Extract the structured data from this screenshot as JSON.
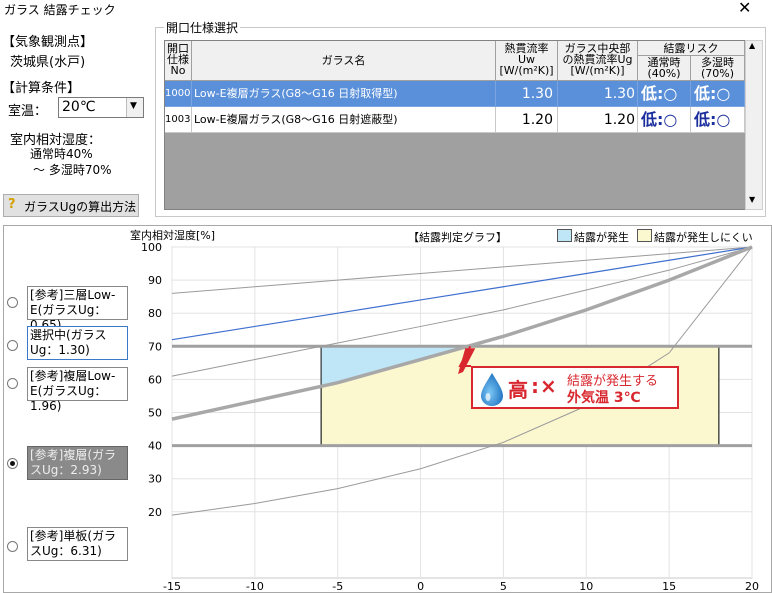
{
  "window": {
    "title": "ガラス 結露チェック",
    "close_glyph": "✕"
  },
  "station": {
    "label": "【気象観測点】",
    "value": "茨城県(水戸)"
  },
  "calc": {
    "label": "【計算条件】",
    "room_temp_label": "室温：",
    "room_temp_value": "20℃",
    "rh_label": "室内相対湿度：",
    "rh_normal": "通常時40%",
    "rh_humid": "～ 多湿時70%"
  },
  "calc_button": {
    "label": "ガラスUgの算出方法"
  },
  "selection": {
    "group_title": "開口仕様選択",
    "headers": {
      "no": [
        "開口",
        "仕様",
        "No"
      ],
      "name": "ガラス名",
      "uw": [
        "熱貫流率",
        "Uw",
        "[W/(m²K)]"
      ],
      "ug": [
        "ガラス中央部",
        "の熱貫流率Ug",
        "[W/(m²K)]"
      ],
      "risk": "結露リスク",
      "risk_normal": [
        "通常時",
        "(40%)"
      ],
      "risk_humid": [
        "多湿時",
        "(70%)"
      ]
    },
    "rows": [
      {
        "no": "1000",
        "name": "Low-E複層ガラス(G8～G16 日射取得型)",
        "uw": "1.30",
        "ug": "1.30",
        "risk_normal": "低:○",
        "risk_humid": "低:○"
      },
      {
        "no": "1003",
        "name": "Low-E複層ガラス(G8～G16 日射遮蔽型)",
        "uw": "1.20",
        "ug": "1.20",
        "risk_normal": "低:○",
        "risk_humid": "低:○"
      }
    ]
  },
  "chart_data": {
    "type": "line",
    "title": "【結露判定グラフ】",
    "ylabel": "室内相対湿度[%]",
    "xlim": [
      -15,
      20
    ],
    "ylim": [
      0,
      100
    ],
    "xticks": [
      -15,
      -10,
      -5,
      0,
      5,
      10,
      15,
      20
    ],
    "yticks": [
      20,
      30,
      40,
      50,
      60,
      70,
      80,
      90,
      100
    ],
    "legend": [
      {
        "label": "結露が発生",
        "color": "#bfe6f7"
      },
      {
        "label": "結露が発生しにくい",
        "color": "#fbf8cf"
      }
    ],
    "zone": {
      "x_range": [
        -6,
        18
      ],
      "rh_range": [
        40,
        70
      ]
    },
    "series": [
      {
        "name": "[参考]三層Low-E(ガラスUg：0.65)",
        "ug": 0.65,
        "color": "#9a9a9a",
        "x": [
          -15,
          -10,
          -5,
          0,
          5,
          10,
          15,
          20
        ],
        "y": [
          86,
          88,
          90,
          92,
          94,
          96,
          98,
          100
        ]
      },
      {
        "name": "選択中(ガラスUg：1.30)",
        "ug": 1.3,
        "color": "#3f6fcf",
        "x": [
          -15,
          -10,
          -5,
          0,
          5,
          10,
          15,
          20
        ],
        "y": [
          72,
          76,
          80,
          84,
          88,
          92,
          96,
          100
        ]
      },
      {
        "name": "[参考]複層Low-E(ガラスUg：1.96)",
        "ug": 1.96,
        "color": "#9a9a9a",
        "x": [
          -15,
          -10,
          -5,
          0,
          5,
          10,
          15,
          20
        ],
        "y": [
          61,
          66,
          71,
          76,
          81,
          87,
          93,
          100
        ]
      },
      {
        "name": "[参考]複層(ガラスUg：2.93)",
        "ug": 2.93,
        "color": "#a8a8a8",
        "x": [
          -15,
          -10,
          -5,
          0,
          5,
          10,
          15,
          20
        ],
        "y": [
          48,
          53.5,
          59,
          66,
          73,
          81,
          90,
          100
        ]
      },
      {
        "name": "[参考]単板(ガラスUg：6.31)",
        "ug": 6.31,
        "color": "#9a9a9a",
        "x": [
          -15,
          -10,
          -5,
          0,
          5,
          10,
          15,
          20
        ],
        "y": [
          19,
          22.5,
          27,
          33,
          41,
          52,
          68,
          100
        ]
      }
    ],
    "selected_series_index": 3,
    "callout": {
      "risk": "高",
      "mark": "×",
      "line1": "結露が発生する",
      "line2": "外気温 3℃",
      "x": 3,
      "y": 70
    }
  }
}
